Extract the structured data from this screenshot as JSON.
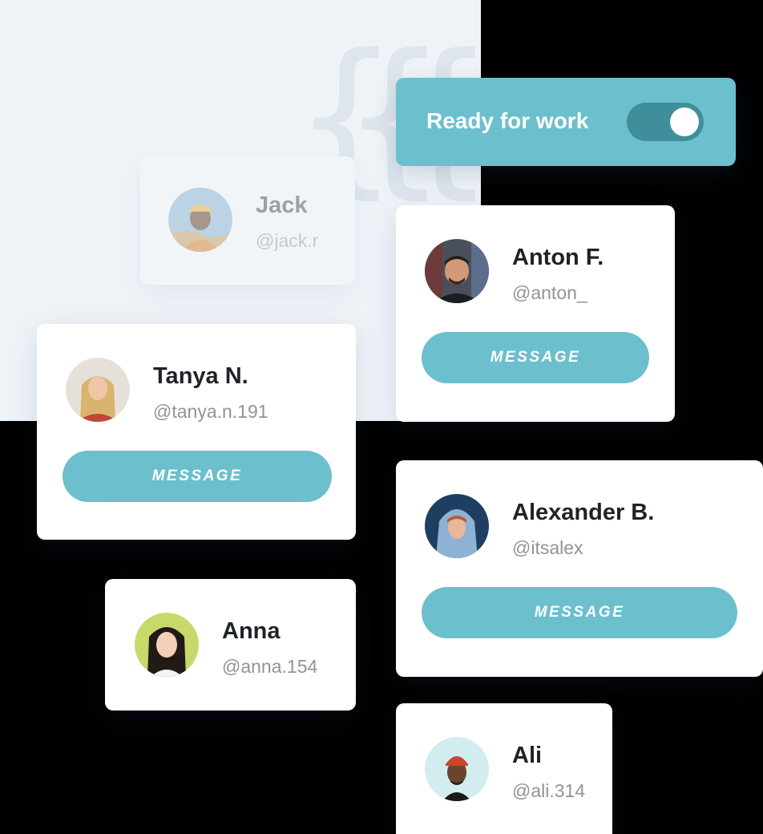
{
  "status_card": {
    "label": "Ready for work",
    "toggle_on": true
  },
  "contacts": {
    "jack": {
      "name": "Jack",
      "handle": "@jack.r"
    },
    "anton": {
      "name": "Anton F.",
      "handle": "@anton_",
      "button": "MESSAGE"
    },
    "tanya": {
      "name": "Tanya N.",
      "handle": "@tanya.n.191",
      "button": "MESSAGE"
    },
    "alexander": {
      "name": "Alexander B.",
      "handle": "@itsalex",
      "button": "MESSAGE"
    },
    "anna": {
      "name": "Anna",
      "handle": "@anna.154"
    },
    "ali": {
      "name": "Ali",
      "handle": "@ali.314"
    }
  },
  "colors": {
    "accent": "#6cbfcc",
    "toggle_track": "#3f8e9b",
    "panel_background": "#eef3f8",
    "card_background": "#ffffff"
  },
  "icons": [
    "avatar-jack",
    "avatar-anton",
    "avatar-tanya",
    "avatar-alexander",
    "avatar-anna",
    "avatar-ali"
  ]
}
